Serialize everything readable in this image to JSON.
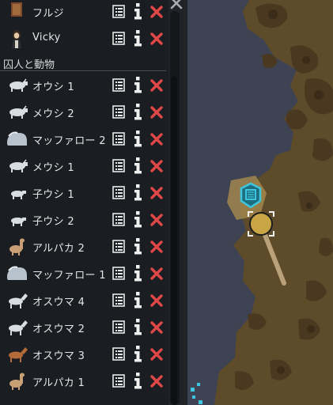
{
  "colonists": [
    {
      "name": "フルジ",
      "icon": "colonist-fluj-icon"
    },
    {
      "name": "Vicky",
      "icon": "colonist-vicky-icon"
    }
  ],
  "section_title": "囚人と動物",
  "animals": [
    {
      "name": "オウシ 1",
      "icon": "cow-icon"
    },
    {
      "name": "メウシ 2",
      "icon": "cow-icon"
    },
    {
      "name": "マッファロー 2",
      "icon": "muffalo-icon"
    },
    {
      "name": "メウシ 1",
      "icon": "cow-icon"
    },
    {
      "name": "子ウシ 1",
      "icon": "calf-icon"
    },
    {
      "name": "子ウシ 2",
      "icon": "calf-icon"
    },
    {
      "name": "アルパカ 2",
      "icon": "alpaca-icon"
    },
    {
      "name": "マッファロー 1",
      "icon": "muffalo-icon"
    },
    {
      "name": "オスウマ 4",
      "icon": "horse-icon"
    },
    {
      "name": "オスウマ 2",
      "icon": "horse-icon"
    },
    {
      "name": "オスウマ 3",
      "icon": "horse-brown-icon"
    },
    {
      "name": "アルパカ 1",
      "icon": "alpaca-icon"
    }
  ],
  "colors": {
    "panel_bg": "#1a1d21",
    "delete_red": "#e04848",
    "water": "#3d4352",
    "dirt": "#5e4b2a",
    "selection_cyan": "#3ec6e0",
    "selected_pawn": "#c9a545"
  }
}
